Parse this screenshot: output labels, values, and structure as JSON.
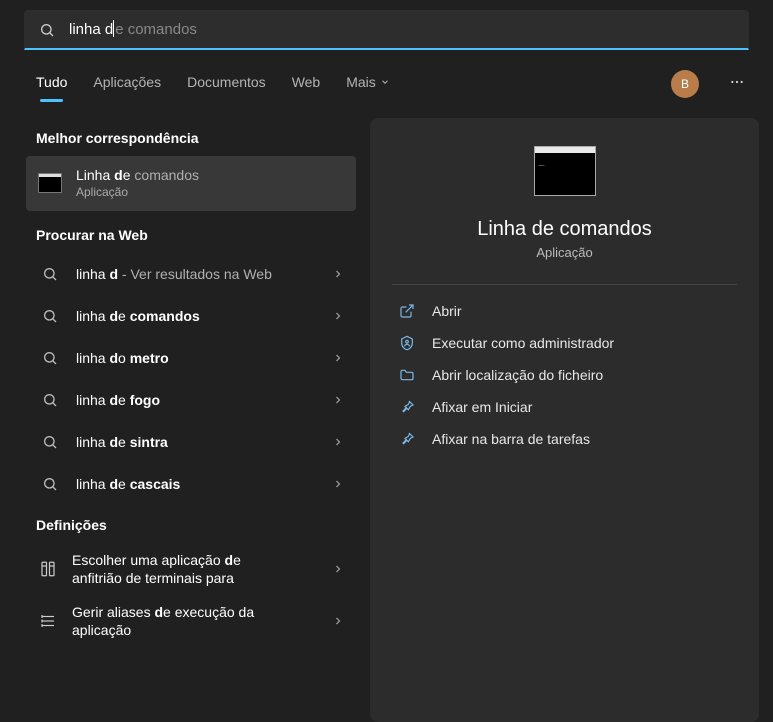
{
  "search": {
    "typed": "linha d",
    "suggestion": "e comandos"
  },
  "tabs": [
    "Tudo",
    "Aplicações",
    "Documentos",
    "Web",
    "Mais"
  ],
  "active_tab": 0,
  "avatar_letter": "B",
  "sections": {
    "best_match": "Melhor correspondência",
    "web": "Procurar na Web",
    "settings": "Definições"
  },
  "best_match": {
    "title_pre": "Linha ",
    "title_bold": "d",
    "title_post": "e",
    "title_dim": " comandos",
    "subtitle": "Aplicação"
  },
  "web_results": [
    {
      "pre": "linha ",
      "bold": "d",
      "post": "",
      "dim": " - Ver resultados na Web"
    },
    {
      "pre": "linha ",
      "bold": "d",
      "post": "e",
      "dim": "",
      "bold2": " comandos"
    },
    {
      "pre": "linha ",
      "bold": "d",
      "post": "o",
      "dim": "",
      "bold2": " metro"
    },
    {
      "pre": "linha ",
      "bold": "d",
      "post": "e",
      "dim": "",
      "bold2": " fogo"
    },
    {
      "pre": "linha ",
      "bold": "d",
      "post": "e",
      "dim": "",
      "bold2": " sintra"
    },
    {
      "pre": "linha ",
      "bold": "d",
      "post": "e",
      "dim": "",
      "bold2": " cascais"
    }
  ],
  "settings_results": [
    {
      "line1_pre": "Escolher uma aplicação ",
      "line1_bold": "d",
      "line1_post": "e",
      "line2": "anfitrião de terminais para"
    },
    {
      "line1_pre": "Gerir aliases ",
      "line1_bold": "d",
      "line1_post": "e",
      "line1_after": " execução da",
      "line2": "aplicação"
    }
  ],
  "preview": {
    "title": "Linha de comandos",
    "type": "Aplicação"
  },
  "actions": [
    {
      "icon": "open",
      "label": "Abrir"
    },
    {
      "icon": "admin",
      "label": "Executar como administrador"
    },
    {
      "icon": "folder",
      "label": "Abrir localização do ficheiro"
    },
    {
      "icon": "pin-start",
      "label": "Afixar em Iniciar"
    },
    {
      "icon": "pin-taskbar",
      "label": "Afixar na barra de tarefas"
    }
  ]
}
